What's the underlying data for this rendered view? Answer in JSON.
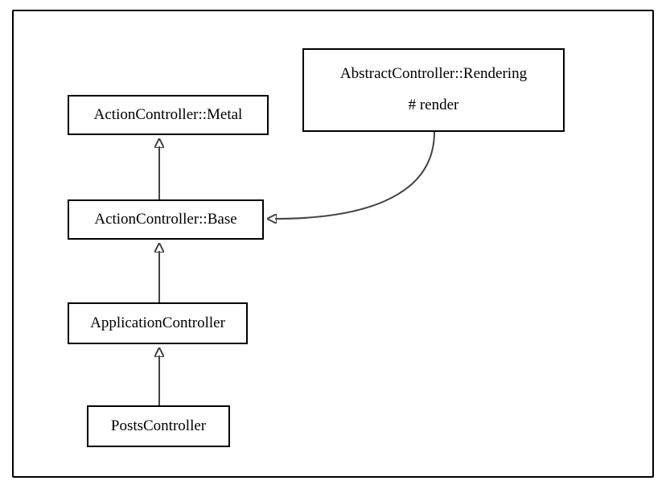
{
  "nodes": {
    "metal": "ActionController::Metal",
    "rendering_title": "AbstractController::Rendering",
    "rendering_method": "# render",
    "base": "ActionController::Base",
    "app": "ApplicationController",
    "posts": "PostsController"
  },
  "edges": [
    {
      "from": "base",
      "to": "metal",
      "type": "inherit"
    },
    {
      "from": "app",
      "to": "base",
      "type": "inherit"
    },
    {
      "from": "posts",
      "to": "app",
      "type": "inherit"
    },
    {
      "from": "rendering",
      "to": "base",
      "type": "include"
    }
  ]
}
